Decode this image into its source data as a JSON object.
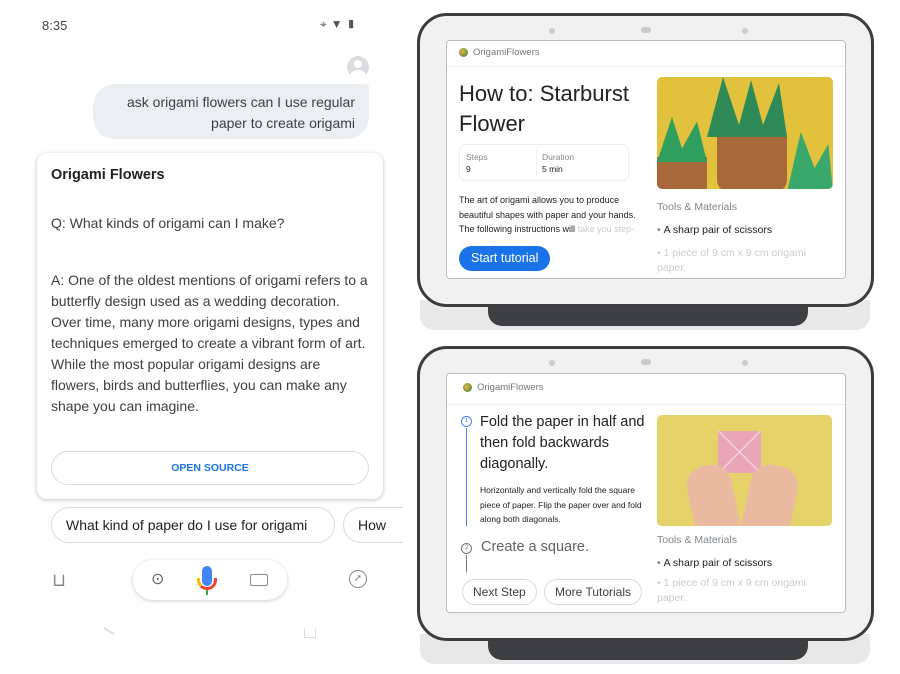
{
  "phone": {
    "time": "8:35",
    "status_icons": [
      "location-icon",
      "wifi-icon",
      "signal-icon",
      "battery-icon"
    ],
    "user_query": "ask origami flowers can I use regular paper to create origami",
    "card": {
      "title": "Origami Flowers",
      "question": "Q: What kinds of origami can I make?",
      "answer": "A: One of the oldest mentions of origami refers to a butterfly design used as a wedding decoration. Over time, many more origami designs, types and techniques emerged to create a vibrant form of art. While the most popular origami designs are flowers, birds and butterflies, you can make any shape you can imagine.",
      "open_source": "OPEN SOURCE"
    },
    "chips": [
      "What kind of paper do I use for origami",
      "How"
    ],
    "bottom_icons": [
      "updates-icon",
      "lens-icon",
      "mic-icon",
      "keyboard-icon",
      "explore-icon"
    ]
  },
  "hub1": {
    "brand": "OrigamiFlowers",
    "title": "How to: Starburst Flower",
    "steps_label": "Steps",
    "steps_value": "9",
    "duration_label": "Duration",
    "duration_value": "5 min",
    "description": "The art of origami allows you to produce beautiful shapes with paper and your hands. The following instructions will",
    "description_faded": "take you step-by-step through the",
    "tools_title": "Tools & Materials",
    "tools": [
      "A sharp pair of scissors",
      "1 piece of 9 cm x 9 cm origami paper."
    ],
    "start_button": "Start tutorial",
    "accent": "#1a73e8"
  },
  "hub2": {
    "brand": "OrigamiFlowers",
    "step1_number": "1",
    "step1_title": "Fold the paper in half and then fold backwards diagonally.",
    "step1_text": "Horizontally and vertically fold the square piece of paper. Flip the paper over and fold along both diagonals.",
    "step2_number": "2",
    "step2_title": "Create a square.",
    "tools_title": "Tools & Materials",
    "tools": [
      "A sharp pair of scissors",
      "1 piece of 9 cm x 9 cm origami paper."
    ],
    "next_button": "Next Step",
    "more_button": "More Tutorials"
  }
}
